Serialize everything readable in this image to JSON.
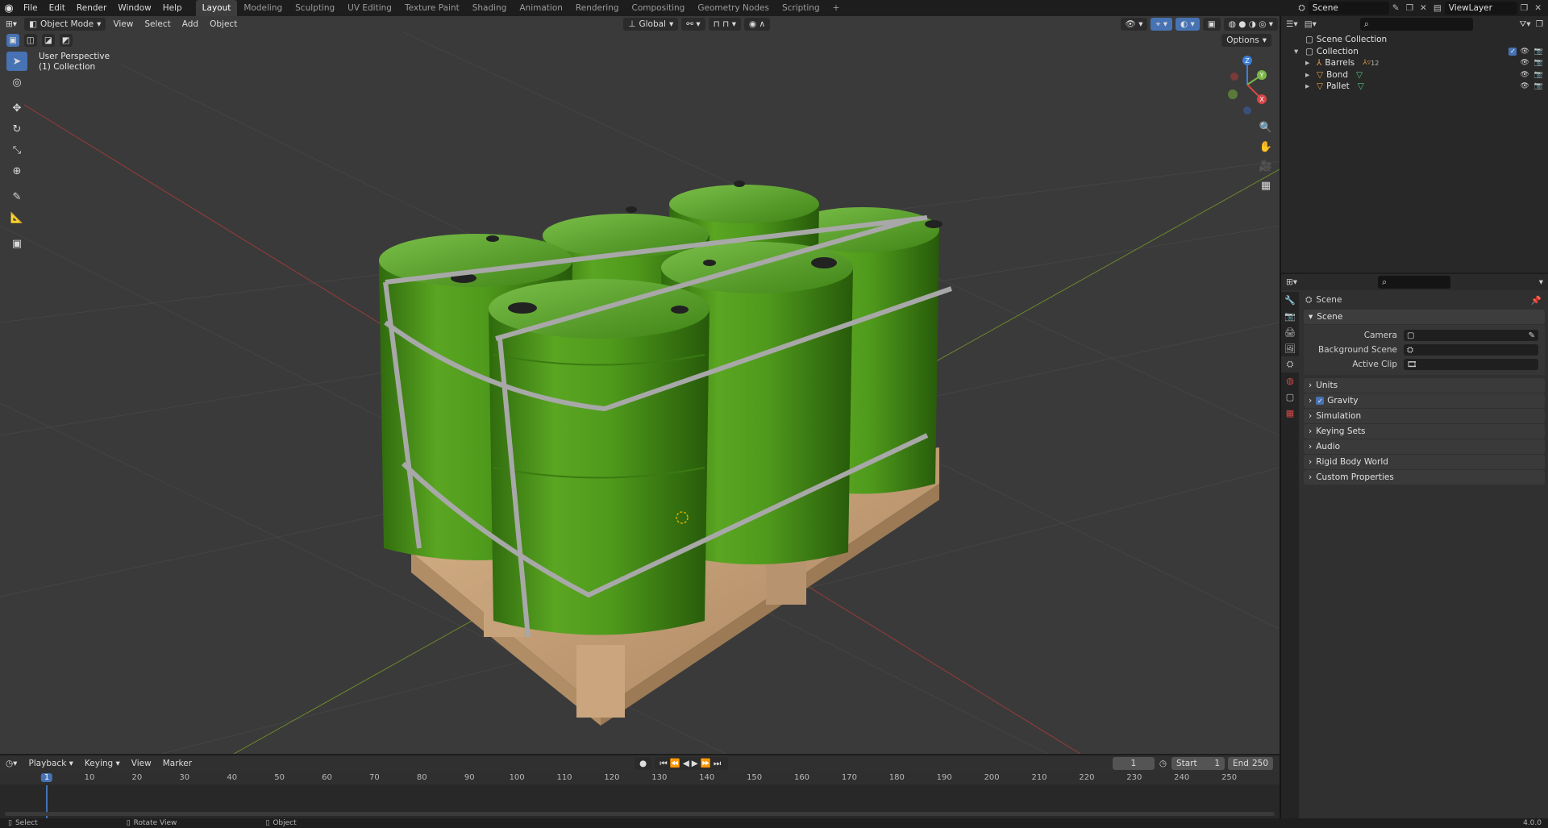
{
  "app": {
    "menus": [
      "File",
      "Edit",
      "Render",
      "Window",
      "Help"
    ],
    "workspaces": [
      "Layout",
      "Modeling",
      "Sculpting",
      "UV Editing",
      "Texture Paint",
      "Shading",
      "Animation",
      "Rendering",
      "Compositing",
      "Geometry Nodes",
      "Scripting"
    ],
    "add_workspace": "+",
    "scene_name": "Scene",
    "view_layer": "ViewLayer",
    "version": "4.0.0"
  },
  "viewport": {
    "mode": "Object Mode",
    "menus": [
      "View",
      "Select",
      "Add",
      "Object"
    ],
    "transform_orientation": "Global",
    "options_label": "Options",
    "perspective_label": "User Perspective",
    "collection_label": "(1) Collection",
    "gizmo_axes": {
      "z": "Z",
      "y": "Y",
      "x": "X"
    }
  },
  "outliner": {
    "root": "Scene Collection",
    "collection": "Collection",
    "items": [
      {
        "name": "Barrels",
        "extra": "12"
      },
      {
        "name": "Bond"
      },
      {
        "name": "Pallet"
      }
    ]
  },
  "properties": {
    "context": "Scene",
    "section": "Scene",
    "fields": [
      {
        "label": "Camera",
        "value": ""
      },
      {
        "label": "Background Scene",
        "value": ""
      },
      {
        "label": "Active Clip",
        "value": ""
      }
    ],
    "panels": [
      "Units",
      "Gravity",
      "Simulation",
      "Keying Sets",
      "Audio",
      "Rigid Body World",
      "Custom Properties"
    ]
  },
  "timeline": {
    "menus": [
      "Playback",
      "Keying",
      "View",
      "Marker"
    ],
    "current_frame": "1",
    "start_label": "Start",
    "start": "1",
    "end_label": "End",
    "end": "250",
    "ticks": [
      "1",
      "10",
      "20",
      "30",
      "40",
      "50",
      "60",
      "70",
      "80",
      "90",
      "100",
      "110",
      "120",
      "130",
      "140",
      "150",
      "160",
      "170",
      "180",
      "190",
      "200",
      "210",
      "220",
      "230",
      "240",
      "250"
    ]
  },
  "status": {
    "select": "Select",
    "rotate": "Rotate View",
    "object": "Object"
  },
  "colors": {
    "accent": "#4772b3",
    "barrel": "#4f9a1c",
    "pallet": "#c8a27a",
    "viewport_bg": "#3a3a3a"
  }
}
